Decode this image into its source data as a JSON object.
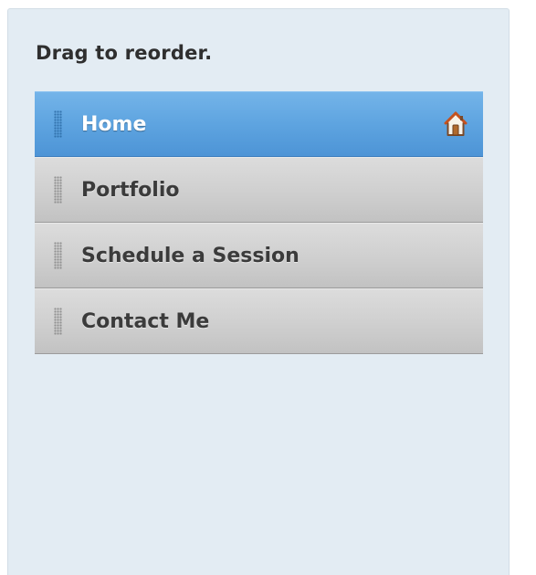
{
  "panel": {
    "instructions": "Drag to reorder."
  },
  "pages": [
    {
      "label": "Home",
      "is_home": true,
      "selected": true
    },
    {
      "label": "Portfolio",
      "is_home": false,
      "selected": false
    },
    {
      "label": "Schedule a Session",
      "is_home": false,
      "selected": false
    },
    {
      "label": "Contact Me",
      "is_home": false,
      "selected": false
    }
  ],
  "icons": {
    "grip": "drag-handle-icon",
    "home": "home-icon"
  },
  "colors": {
    "selected_item": "#5ea4e0",
    "item": "#cfcfcf",
    "panel_background": "#e3ecf3"
  }
}
